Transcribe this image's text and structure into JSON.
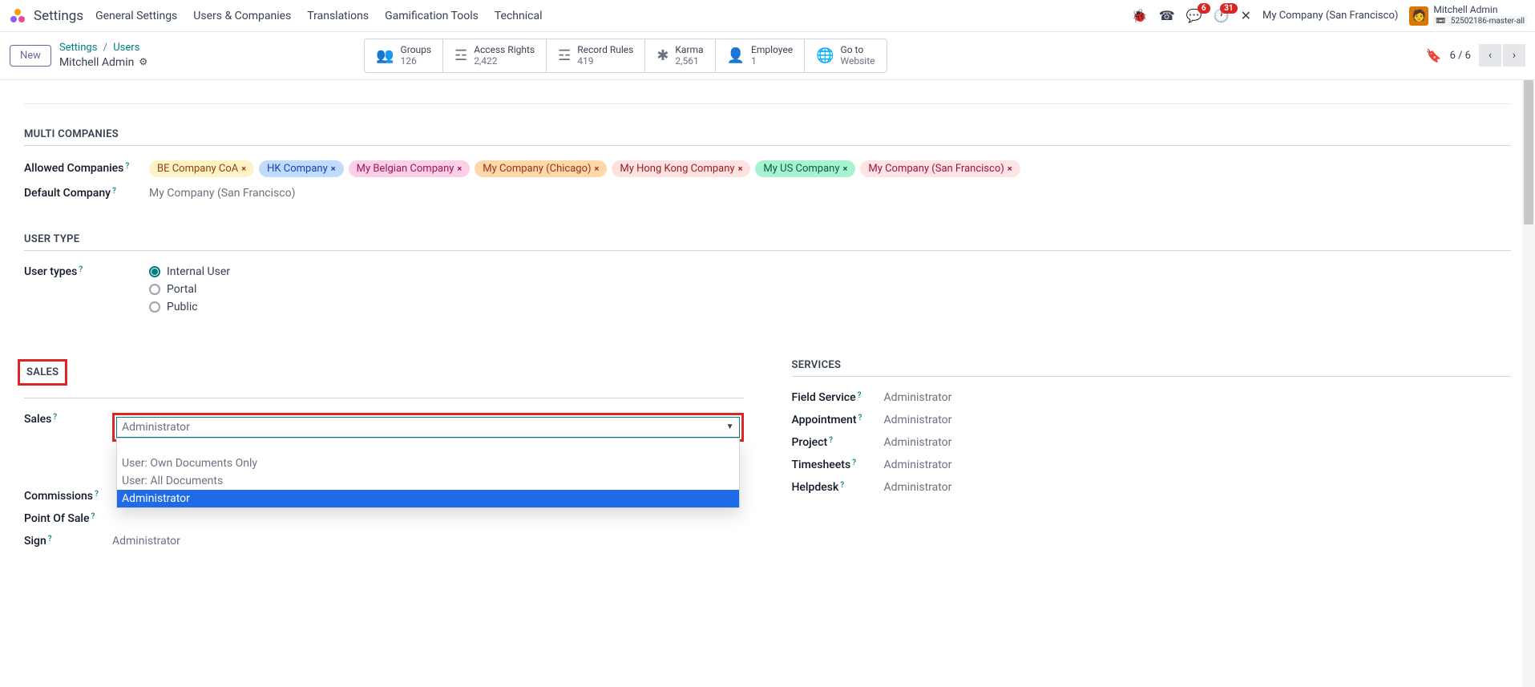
{
  "header": {
    "app_name": "Settings",
    "nav": [
      "General Settings",
      "Users & Companies",
      "Translations",
      "Gamification Tools",
      "Technical"
    ],
    "messages_badge": "6",
    "activities_badge": "31",
    "company": "My Company (San Francisco)",
    "user_name": "Mitchell Admin",
    "user_db": "52502186-master-all"
  },
  "subheader": {
    "new_btn": "New",
    "breadcrumb_settings": "Settings",
    "breadcrumb_users": "Users",
    "record_name": "Mitchell Admin",
    "stats": [
      {
        "icon": "👥",
        "label": "Groups",
        "value": "126"
      },
      {
        "icon": "☲",
        "label": "Access Rights",
        "value": "2,422"
      },
      {
        "icon": "☲",
        "label": "Record Rules",
        "value": "419"
      },
      {
        "icon": "✱",
        "label": "Karma",
        "value": "2,561"
      },
      {
        "icon": "👤",
        "label": "Employee",
        "value": "1"
      },
      {
        "icon": "🌐",
        "label": "Go to",
        "value": "Website"
      }
    ],
    "pager": "6 / 6"
  },
  "sections": {
    "multi_companies": "MULTI COMPANIES",
    "user_type": "USER TYPE",
    "sales": "SALES",
    "services": "SERVICES"
  },
  "fields": {
    "allowed_companies": "Allowed Companies",
    "default_company": "Default Company",
    "user_types": "User types",
    "sales": "Sales",
    "commissions": "Commissions",
    "point_of_sale": "Point Of Sale",
    "sign": "Sign",
    "field_service": "Field Service",
    "appointment": "Appointment",
    "project": "Project",
    "timesheets": "Timesheets",
    "helpdesk": "Helpdesk"
  },
  "values": {
    "default_company": "My Company (San Francisco)",
    "sign": "Administrator",
    "field_service": "Administrator",
    "appointment": "Administrator",
    "project": "Administrator",
    "timesheets": "Administrator",
    "helpdesk": "Administrator"
  },
  "companies_tags": [
    {
      "name": "BE Company CoA",
      "cls": "tag-yellow"
    },
    {
      "name": "HK Company",
      "cls": "tag-blue"
    },
    {
      "name": "My Belgian Company",
      "cls": "tag-pink"
    },
    {
      "name": "My Company (Chicago)",
      "cls": "tag-orange"
    },
    {
      "name": "My Hong Kong Company",
      "cls": "tag-peach"
    },
    {
      "name": "My US Company",
      "cls": "tag-teal"
    },
    {
      "name": "My Company (San Francisco)",
      "cls": "tag-rose"
    }
  ],
  "user_types_options": [
    "Internal User",
    "Portal",
    "Public"
  ],
  "user_types_selected": "Internal User",
  "sales_dropdown": {
    "selected": "Administrator",
    "options": [
      "",
      "User: Own Documents Only",
      "User: All Documents",
      "Administrator"
    ]
  },
  "help_q": "?"
}
